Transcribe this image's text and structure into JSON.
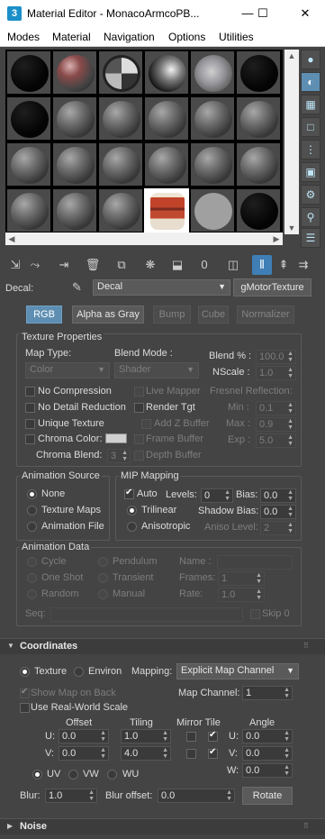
{
  "window": {
    "title": "Material Editor - MonacoArmcoPB...",
    "app_icon": "3",
    "minimize": "—",
    "maximize": "☐",
    "close": "✕"
  },
  "menu": [
    "Modes",
    "Material",
    "Navigation",
    "Options",
    "Utilities"
  ],
  "decal": {
    "label": "Decal:",
    "material_name": "Decal",
    "material_type": "gMotorTexture"
  },
  "channel_tabs": {
    "rgb": "RGB",
    "alpha_as_gray": "Alpha as Gray",
    "bump": "Bump",
    "cube": "Cube",
    "normalizer": "Normalizer"
  },
  "texture_properties": {
    "title": "Texture Properties",
    "map_type_label": "Map Type:",
    "map_type_value": "Color",
    "blend_mode_label": "Blend Mode :",
    "blend_mode_value": "Shader",
    "blend_pct_label": "Blend % :",
    "blend_pct_value": "100.0",
    "nscale_label": "NScale :",
    "nscale_value": "1.0",
    "no_compression": "No Compression",
    "live_mapper": "Live Mapper",
    "fresnel_label": "Fresnel Reflection:",
    "no_detail_reduction": "No Detail Reduction",
    "render_tgt": "Render Tgt",
    "min_label": "Min :",
    "min_value": "0.1",
    "unique_texture": "Unique Texture",
    "add_z_buffer": "Add Z Buffer",
    "max_label": "Max :",
    "max_value": "0.9",
    "chroma_color": "Chroma Color:",
    "frame_buffer": "Frame Buffer",
    "exp_label": "Exp :",
    "exp_value": "5.0",
    "chroma_blend_label": "Chroma Blend:",
    "chroma_blend_value": "3",
    "depth_buffer": "Depth Buffer"
  },
  "animation_source": {
    "title": "Animation Source",
    "none": "None",
    "texture_maps": "Texture Maps",
    "animation_file": "Animation File"
  },
  "mip_mapping": {
    "title": "MIP Mapping",
    "auto": "Auto",
    "levels_label": "Levels:",
    "levels_value": "0",
    "bias_label": "Bias:",
    "bias_value": "0.0",
    "trilinear": "Trilinear",
    "shadow_bias_label": "Shadow Bias:",
    "shadow_bias_value": "0.0",
    "anisotropic": "Anisotropic",
    "aniso_level_label": "Aniso Level:",
    "aniso_level_value": "2"
  },
  "animation_data": {
    "title": "Animation Data",
    "cycle": "Cycle",
    "pendulum": "Pendulum",
    "name_label": "Name :",
    "one_shot": "One Shot",
    "transient": "Transient",
    "frames_label": "Frames:",
    "frames_value": "1",
    "random": "Random",
    "manual": "Manual",
    "rate_label": "Rate:",
    "rate_value": "1.0",
    "seq_label": "Seq:",
    "skip_label": "Skip 0"
  },
  "coordinates": {
    "title": "Coordinates",
    "texture": "Texture",
    "environ": "Environ",
    "mapping_label": "Mapping:",
    "mapping_value": "Explicit Map Channel",
    "show_map_on_back": "Show Map on Back",
    "map_channel_label": "Map Channel:",
    "map_channel_value": "1",
    "use_real_world": "Use Real-World Scale",
    "offset_label": "Offset",
    "tiling_label": "Tiling",
    "mirror_tile_label": "Mirror Tile",
    "angle_label": "Angle",
    "u_label": "U:",
    "u_offset": "0.0",
    "u_tiling": "1.0",
    "u_angle_label": "U:",
    "u_angle": "0.0",
    "v_label": "V:",
    "v_offset": "0.0",
    "v_tiling": "4.0",
    "v_angle_label": "V:",
    "v_angle": "0.0",
    "w_angle_label": "W:",
    "w_angle": "0.0",
    "uv": "UV",
    "vw": "VW",
    "wu": "WU",
    "blur_label": "Blur:",
    "blur_value": "1.0",
    "blur_offset_label": "Blur offset:",
    "blur_offset_value": "0.0",
    "rotate": "Rotate"
  },
  "noise": {
    "title": "Noise"
  },
  "colors": {
    "background": "#444444",
    "accent": "#5e8fb3",
    "toolbar_active": "#3f7fb5"
  }
}
